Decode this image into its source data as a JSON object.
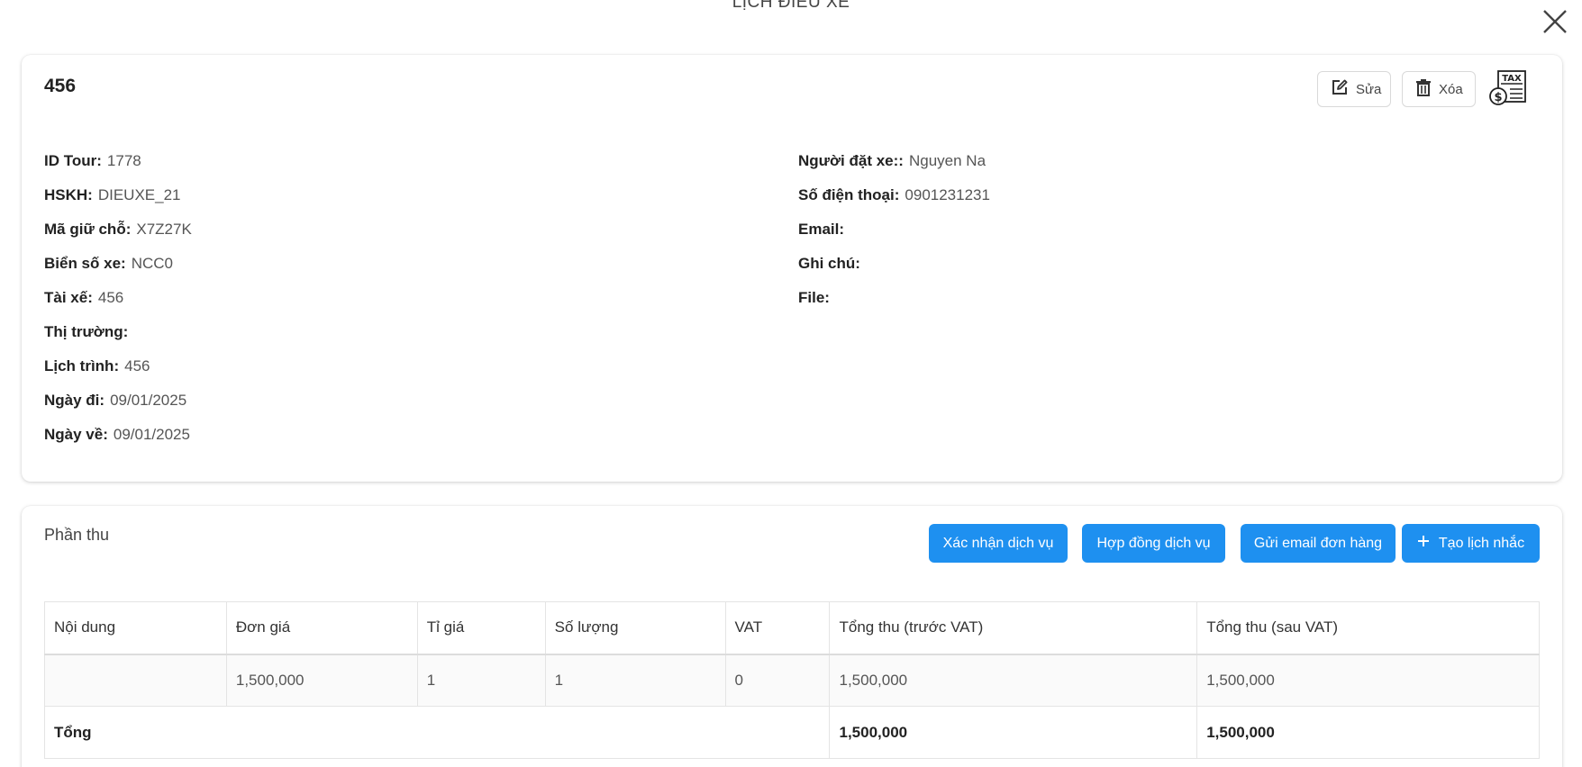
{
  "modal": {
    "title": "LỊCH ĐIỀU XE"
  },
  "info": {
    "title": "456",
    "actions": {
      "edit_label": "Sửa",
      "delete_label": "Xóa"
    },
    "left_fields": [
      {
        "label": "ID Tour",
        "value": "1778"
      },
      {
        "label": "HSKH",
        "value": "DIEUXE_21"
      },
      {
        "label": "Mã giữ chỗ",
        "value": "X7Z27K"
      },
      {
        "label": "Biển số xe",
        "value": "NCC0"
      },
      {
        "label": "Tài xế",
        "value": "456"
      },
      {
        "label": "Thị trường",
        "value": ""
      },
      {
        "label": "Lịch trình",
        "value": "456"
      },
      {
        "label": "Ngày đi",
        "value": "09/01/2025"
      },
      {
        "label": "Ngày về",
        "value": "09/01/2025"
      }
    ],
    "right_fields": [
      {
        "label": "Người đặt xe:",
        "value": "Nguyen Na"
      },
      {
        "label": "Số điện thoại",
        "value": "0901231231"
      },
      {
        "label": "Email",
        "value": ""
      },
      {
        "label": "Ghi chú",
        "value": ""
      },
      {
        "label": "File",
        "value": ""
      }
    ]
  },
  "revenue": {
    "title": "Phần thu",
    "buttons": {
      "confirm": "Xác nhận dịch vụ",
      "contract": "Hợp đồng dịch vụ",
      "email": "Gửi email đơn hàng",
      "reminder": "Tạo lịch nhắc"
    },
    "columns": [
      "Nội dung",
      "Đơn giá",
      "Tỉ giá",
      "Số lượng",
      "VAT",
      "Tổng thu (trước VAT)",
      "Tổng thu (sau VAT)"
    ],
    "rows": [
      [
        "",
        "1,500,000",
        "1",
        "1",
        "0",
        "1,500,000",
        "1,500,000"
      ]
    ],
    "total": {
      "label": "Tổng",
      "before_vat": "1,500,000",
      "after_vat": "1,500,000"
    }
  },
  "colors": {
    "primary": "#1e90f0",
    "border": "#d9d9d9"
  }
}
